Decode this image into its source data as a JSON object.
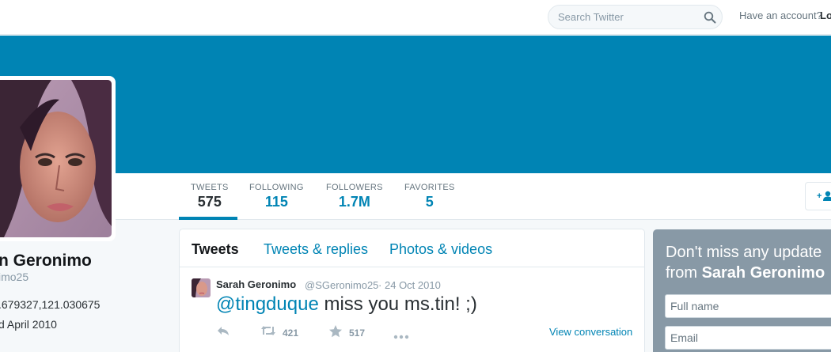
{
  "header": {
    "search_placeholder": "Search Twitter",
    "have_account": "Have an account?",
    "login_label": "Lo"
  },
  "colors": {
    "brand_blue": "#0084b4",
    "banner": "#0084b4",
    "signup_bg": "#8899a6"
  },
  "profile": {
    "name": "n Geronimo",
    "handle": "imo25",
    "location": ".679327,121.030675",
    "joined": "d April 2010"
  },
  "stats": [
    {
      "label": "TWEETS",
      "value": "575"
    },
    {
      "label": "FOLLOWING",
      "value": "115"
    },
    {
      "label": "FOLLOWERS",
      "value": "1.7M"
    },
    {
      "label": "FAVORITES",
      "value": "5"
    }
  ],
  "timeline": {
    "tabs": [
      "Tweets",
      "Tweets & replies",
      "Photos & videos"
    ],
    "tweet": {
      "name": "Sarah Geronimo",
      "handle": "@SGeronimo25",
      "separator": "·",
      "time": "24 Oct 2010",
      "mention": "@tingduque",
      "text": " miss you ms.tin! ;)",
      "retweets": "421",
      "favorites": "517",
      "view_conversation": "View conversation"
    }
  },
  "signup": {
    "title_line1": "Don't miss any update",
    "title_from": "from ",
    "title_name": "Sarah Geronimo",
    "fullname_placeholder": "Full name",
    "email_placeholder": "Email"
  },
  "icons": {
    "search": "search-icon",
    "follow": "add-user-icon",
    "reply": "reply-icon",
    "retweet": "retweet-icon",
    "favorite": "star-icon",
    "more": "more-icon"
  }
}
